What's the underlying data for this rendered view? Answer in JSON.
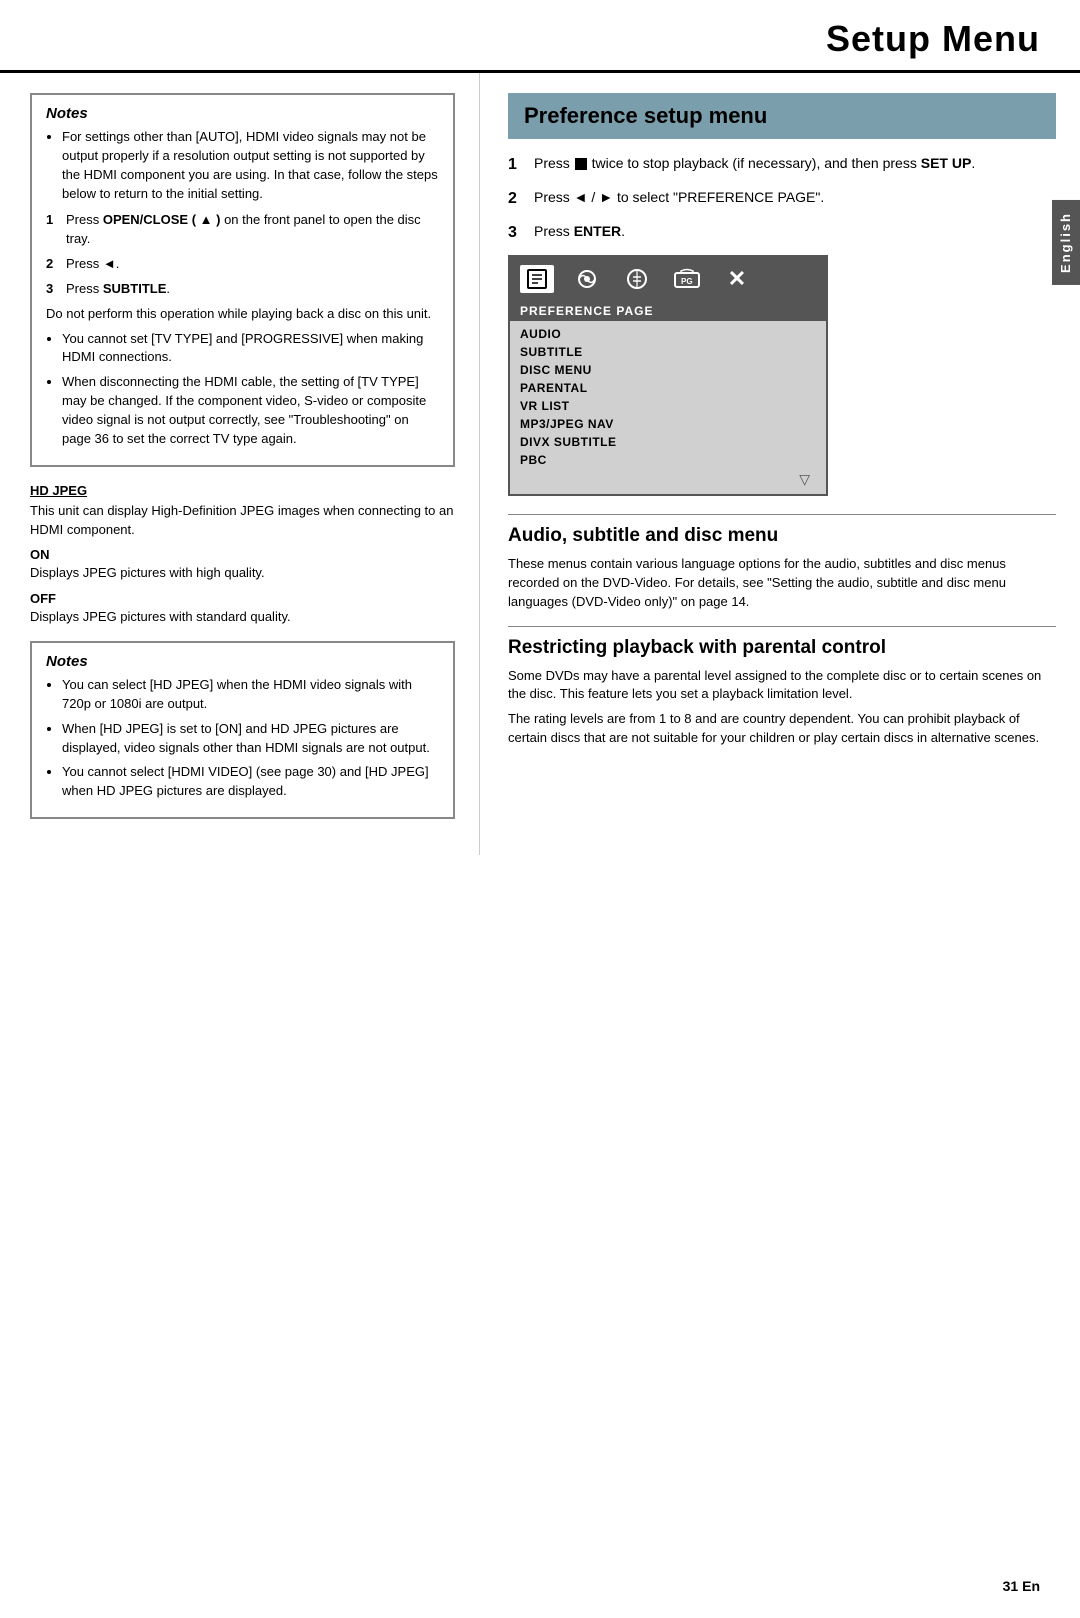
{
  "header": {
    "title": "Setup Menu"
  },
  "english_tab": "English",
  "left_column": {
    "notes1": {
      "title": "Notes",
      "bullets": [
        "For settings other than [AUTO], HDMI video signals may not be output properly if a resolution output setting is not supported by the HDMI component you are using. In that case, follow the steps below to return to the initial setting.",
        "You cannot set [TV TYPE] and [PROGRESSIVE] when making HDMI connections.",
        "When disconnecting the HDMI cable, the setting of [TV TYPE] may be changed. If the component video, S-video or composite video signal is not output correctly, see \"Troubleshooting\" on page 36 to set the correct TV type again."
      ],
      "step1": "Press OPEN/CLOSE ( ▲ ) on the front panel to open the disc tray.",
      "step2": "Press ◄.",
      "step3": "Press SUBTITLE.",
      "step3_note": "Do not perform this operation while playing back a disc on this unit."
    },
    "hd_jpeg": {
      "heading": "HD JPEG",
      "body": "This unit can display High-Definition JPEG images when connecting to an HDMI component.",
      "on_label": "ON",
      "on_desc": "Displays JPEG pictures with high quality.",
      "off_label": "OFF",
      "off_desc": "Displays JPEG pictures with standard quality."
    },
    "notes2": {
      "title": "Notes",
      "bullets": [
        "You can select [HD JPEG] when the HDMI video signals with 720p or 1080i are output.",
        "When [HD JPEG] is set to [ON] and HD JPEG pictures are displayed, video signals other than HDMI signals are not output.",
        "You cannot select [HDMI VIDEO] (see page 30) and [HD JPEG] when HD JPEG pictures are displayed."
      ]
    }
  },
  "right_column": {
    "pref_header": "Preference setup menu",
    "step1": {
      "num": "1",
      "text_before": "Press",
      "stop_symbol": "■",
      "text_after": "twice to stop playback (if necessary), and then press",
      "bold_text": "SET UP",
      "period": "."
    },
    "step2": {
      "num": "2",
      "text": "Press ◄ / ► to select \"PREFERENCE PAGE\"."
    },
    "step3": {
      "num": "3",
      "text_before": "Press",
      "bold_text": "ENTER",
      "period": "."
    },
    "menu": {
      "icons": [
        "□",
        "⚙",
        "⊗",
        "📋",
        "✕"
      ],
      "pref_row": "PREFERENCE PAGE",
      "items": [
        "AUDIO",
        "SUBTITLE",
        "DISC MENU",
        "PARENTAL",
        "VR LIST",
        "MP3/JPEG NAV",
        "DIVX SUBTITLE",
        "PBC"
      ]
    },
    "audio_section": {
      "title": "Audio, subtitle and disc menu",
      "body": "These menus contain various language options for the audio, subtitles and disc menus recorded on the DVD-Video. For details, see \"Setting the audio, subtitle and disc menu languages (DVD-Video only)\" on page 14."
    },
    "parental_section": {
      "title": "Restricting playback with parental control",
      "body1": "Some DVDs may have a parental level assigned to the complete disc or to certain scenes on the disc. This feature lets you set a playback limitation level.",
      "body2": "The rating levels are from 1 to 8 and are country dependent. You can prohibit playback of certain discs that are not suitable for your children or play certain discs in alternative scenes."
    }
  },
  "page_number": "31 En"
}
